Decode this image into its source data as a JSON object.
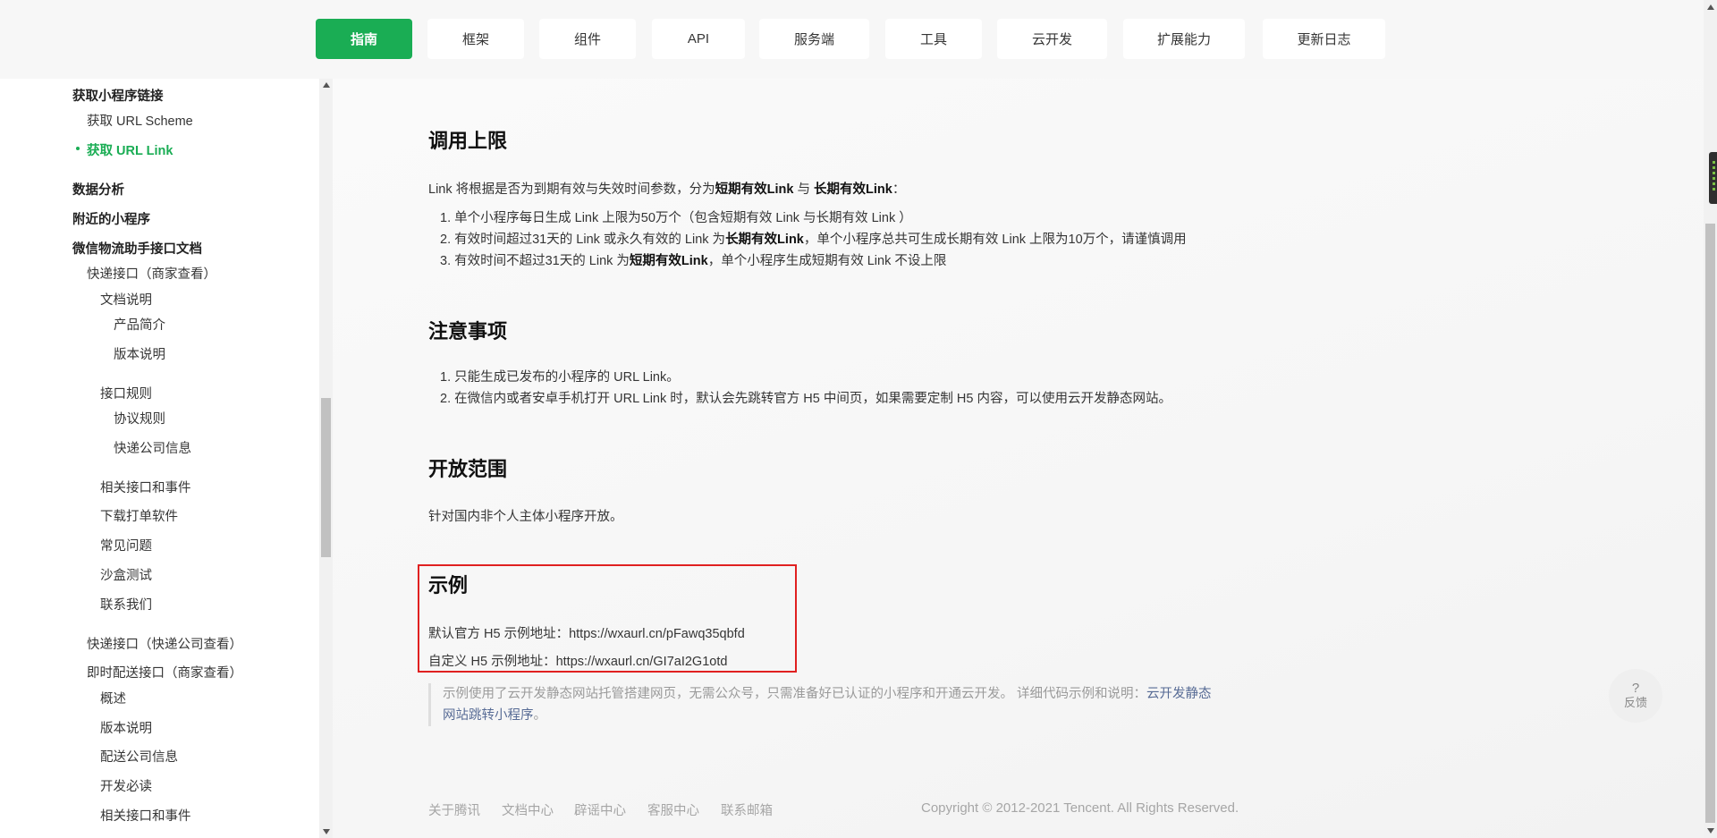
{
  "nav": {
    "tabs": [
      {
        "label": "指南",
        "active": true
      },
      {
        "label": "框架"
      },
      {
        "label": "组件"
      },
      {
        "label": "API"
      },
      {
        "label": "服务端"
      },
      {
        "label": "工具"
      },
      {
        "label": "云开发"
      },
      {
        "label": "扩展能力"
      },
      {
        "label": "更新日志"
      }
    ],
    "active_color": "#1aad54"
  },
  "sidebar": {
    "items": [
      {
        "label": "获取小程序链接"
      },
      {
        "label": "获取 URL Scheme"
      },
      {
        "label": "获取 URL Link",
        "active": true
      },
      {
        "label": "数据分析"
      },
      {
        "label": "附近的小程序"
      },
      {
        "label": "微信物流助手接口文档"
      },
      {
        "label": "快递接口（商家查看）"
      },
      {
        "label": "文档说明"
      },
      {
        "label": "产品简介"
      },
      {
        "label": "版本说明"
      },
      {
        "label": "接口规则"
      },
      {
        "label": "协议规则"
      },
      {
        "label": "快递公司信息"
      },
      {
        "label": "相关接口和事件"
      },
      {
        "label": "下载打单软件"
      },
      {
        "label": "常见问题"
      },
      {
        "label": "沙盒测试"
      },
      {
        "label": "联系我们"
      },
      {
        "label": "快递接口（快递公司查看）"
      },
      {
        "label": "即时配送接口（商家查看）"
      },
      {
        "label": "概述"
      },
      {
        "label": "版本说明"
      },
      {
        "label": "配送公司信息"
      },
      {
        "label": "开发必读"
      },
      {
        "label": "相关接口和事件"
      }
    ]
  },
  "main": {
    "limit_section": {
      "title": "调用上限",
      "intro_prefix": "Link 将根据是否为到期有效与失效时间参数，分为",
      "intro_bold1": "短期有效Link",
      "intro_mid": " 与 ",
      "intro_bold2": "长期有效Link",
      "intro_suffix": "：",
      "items": {
        "i1": "1. 单个小程序每日生成 Link 上限为50万个（包含短期有效 Link 与长期有效 Link ）",
        "i2_prefix": "2. 有效时间超过31天的 Link 或永久有效的 Link 为",
        "i2_bold": "长期有效Link",
        "i2_suffix": "，单个小程序总共可生成长期有效 Link 上限为10万个，请谨慎调用",
        "i3_prefix": "3. 有效时间不超过31天的 Link 为",
        "i3_bold": "短期有效Link",
        "i3_suffix": "，单个小程序生成短期有效 Link 不设上限"
      }
    },
    "notes_section": {
      "title": "注意事项",
      "items": [
        "1. 只能生成已发布的小程序的 URL Link。",
        "2. 在微信内或者安卓手机打开 URL Link 时，默认会先跳转官方 H5 中间页，如果需要定制 H5 内容，可以使用云开发静态网站。"
      ]
    },
    "scope_section": {
      "title": "开放范围",
      "text": "针对国内非个人主体小程序开放。"
    },
    "example_section": {
      "title": "示例",
      "line1": "默认官方 H5 示例地址：https://wxaurl.cn/pFawq35qbfd",
      "line2": "自定义 H5 示例地址：https://wxaurl.cn/GI7aI2G1otd"
    },
    "note": {
      "text": "示例使用了云开发静态网站托管搭建网页，无需公众号，只需准备好已认证的小程序和开通云开发。 详细代码示例和说明：",
      "link1": "云开发静态",
      "link2": "网站跳转小程序",
      "tail": "。"
    }
  },
  "footer": {
    "links": [
      "关于腾讯",
      "文档中心",
      "辟谣中心",
      "客服中心",
      "联系邮箱"
    ],
    "copyright": "Copyright © 2012-2021 Tencent. All Rights Reserved."
  },
  "feedback": {
    "icon": "?",
    "label": "反馈"
  }
}
